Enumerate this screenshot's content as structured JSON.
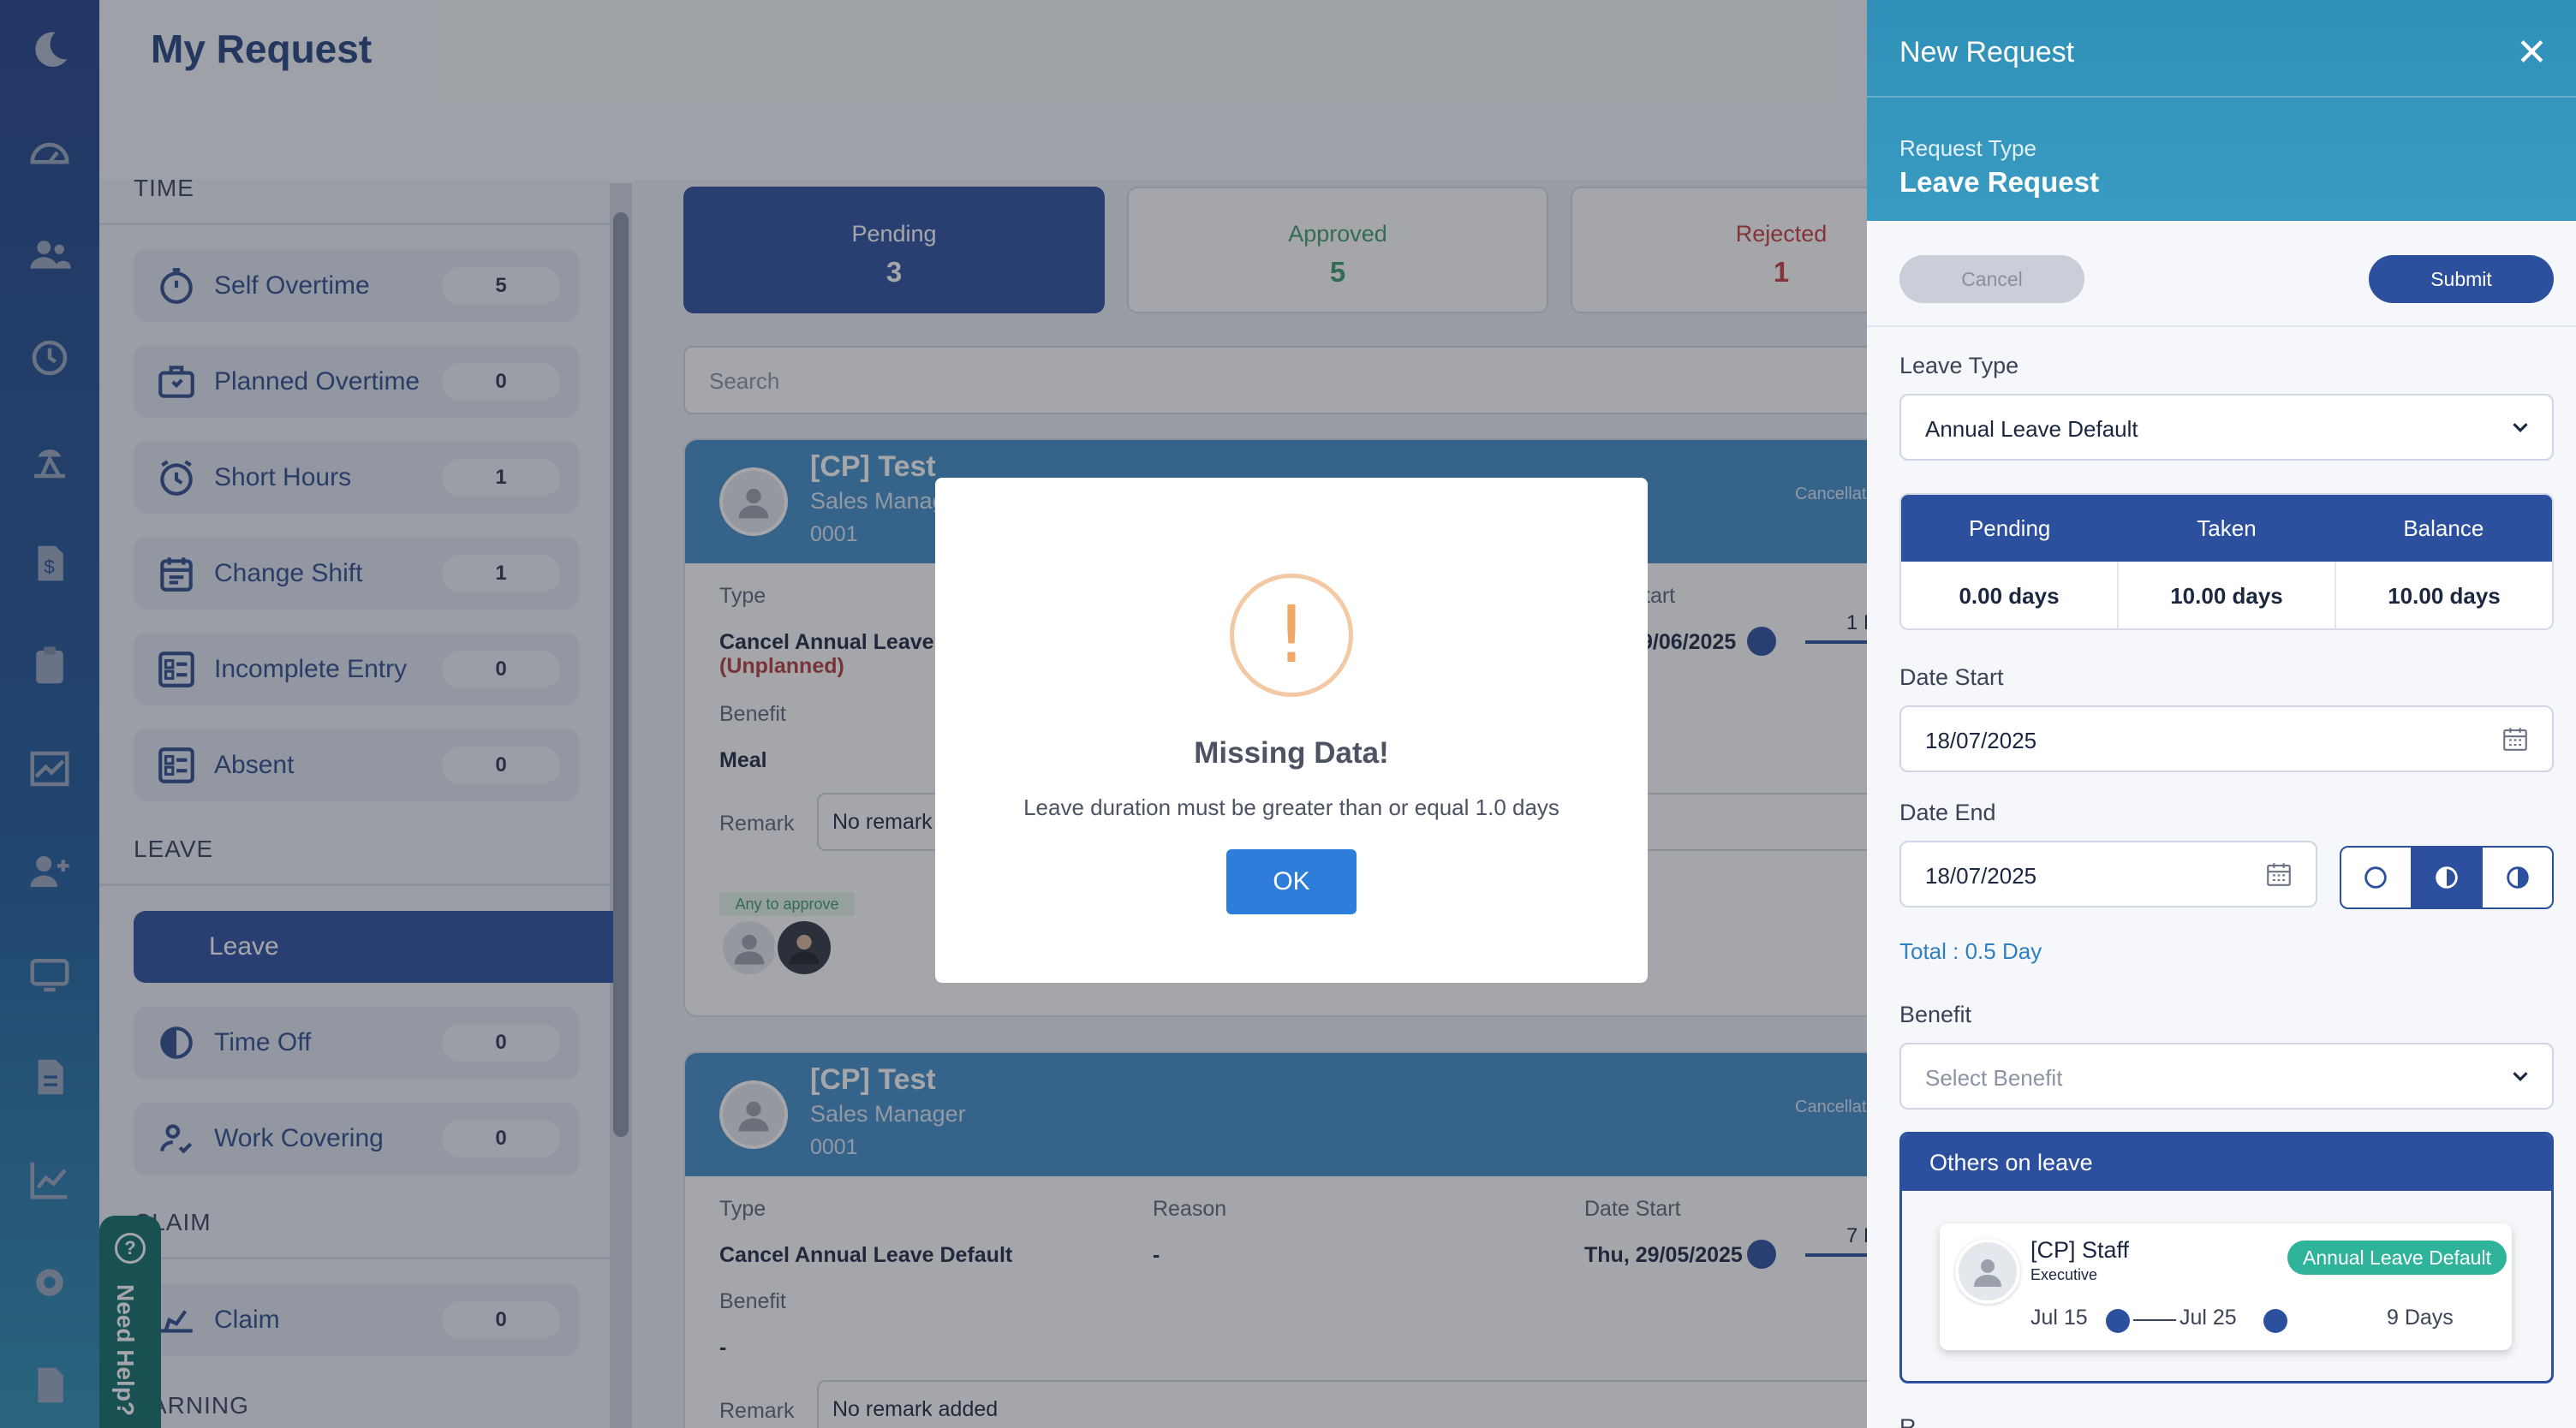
{
  "header": {
    "title": "My Request"
  },
  "rail": {
    "icons": [
      "moon-logo-icon",
      "dashboard-icon",
      "people-icon",
      "history-icon",
      "leave-icon",
      "claim-icon",
      "clipboard-icon",
      "chart-icon",
      "add-user-icon",
      "screen-icon",
      "document-icon",
      "analytics-icon",
      "settings-icon",
      "file-download-icon"
    ]
  },
  "sidebar": {
    "section_time": "TIME",
    "time_items": [
      {
        "label": "Self Overtime",
        "count": "5",
        "icon": "stopwatch-icon"
      },
      {
        "label": "Planned Overtime",
        "count": "0",
        "icon": "briefcase-clock-icon"
      },
      {
        "label": "Short Hours",
        "count": "1",
        "icon": "alarm-clock-icon"
      },
      {
        "label": "Change Shift",
        "count": "1",
        "icon": "calendar-icon"
      },
      {
        "label": "Incomplete Entry",
        "count": "0",
        "icon": "form-icon"
      },
      {
        "label": "Absent",
        "count": "0",
        "icon": "form-icon"
      }
    ],
    "section_leave": "LEAVE",
    "leave_items": [
      {
        "label": "Leave"
      },
      {
        "label": "Time Off",
        "count": "0",
        "icon": "time-off-icon"
      },
      {
        "label": "Work Covering",
        "count": "0",
        "icon": "work-covering-icon"
      }
    ],
    "section_claim": "CLAIM",
    "claim_items": [
      {
        "label": "Claim",
        "count": "0",
        "icon": "claim-hand-icon"
      }
    ],
    "section_warning": "ARNING"
  },
  "status_tabs": [
    {
      "label": "Pending",
      "count": "3"
    },
    {
      "label": "Approved",
      "count": "5"
    },
    {
      "label": "Rejected",
      "count": "1"
    }
  ],
  "search": {
    "placeholder": "Search"
  },
  "requests": [
    {
      "name": "[CP] Test",
      "position": "Sales Manag",
      "id": "0001",
      "cancel_label": "Cancellati",
      "type_label": "Type",
      "type_value": "Cancel Annual Leave I",
      "type_note": "(Unplanned)",
      "date_start_label": "tart",
      "date_start_value": "9/06/2025",
      "duration": "1 D",
      "benefit_label": "Benefit",
      "benefit_value": "Meal",
      "remark_label": "Remark",
      "remark_value": "No remark a",
      "approve_badge": "Any to approve"
    },
    {
      "name": "[CP] Test",
      "position": "Sales Manager",
      "id": "0001",
      "cancel_label": "Cancellati",
      "type_label": "Type",
      "type_value": "Cancel Annual Leave Default",
      "reason_label": "Reason",
      "reason_value": "-",
      "date_start_label": "Date Start",
      "date_start_value": "Thu, 29/05/2025",
      "duration": "7 D",
      "benefit_label": "Benefit",
      "benefit_value": "-",
      "remark_label": "Remark",
      "remark_value": "No remark added"
    }
  ],
  "modal": {
    "icon_glyph": "!",
    "title": "Missing Data!",
    "message": "Leave duration must be greater than or equal 1.0 days",
    "ok_label": "OK"
  },
  "panel": {
    "title": "New Request",
    "close_glyph": "✕",
    "request_type_label": "Request Type",
    "request_type_value": "Leave Request",
    "cancel_label": "Cancel",
    "submit_label": "Submit",
    "leave_type_label": "Leave Type",
    "leave_type_value": "Annual Leave Default",
    "balance": {
      "headers": [
        "Pending",
        "Taken",
        "Balance"
      ],
      "values": [
        "0.00 days",
        "10.00 days",
        "10.00 days"
      ]
    },
    "date_start_label": "Date Start",
    "date_start_value": "18/07/2025",
    "date_end_label": "Date End",
    "date_end_value": "18/07/2025",
    "total": "Total : 0.5 Day",
    "benefit_label": "Benefit",
    "benefit_placeholder": "Select Benefit",
    "others_title": "Others on leave",
    "others": [
      {
        "name": "[CP] Staff",
        "role": "Executive",
        "leave_type": "Annual Leave Default",
        "from": "Jul 15",
        "to": "Jul 25",
        "days": "9 Days"
      }
    ],
    "cut_label": "R"
  },
  "need_help": "Need Help?",
  "colors": {
    "primary": "#2c4f9e",
    "accent": "#3f8cc9",
    "approved": "#3b9a6a",
    "rejected": "#c43c3c",
    "badge": "#2fb39a",
    "warning": "#f0a868"
  }
}
